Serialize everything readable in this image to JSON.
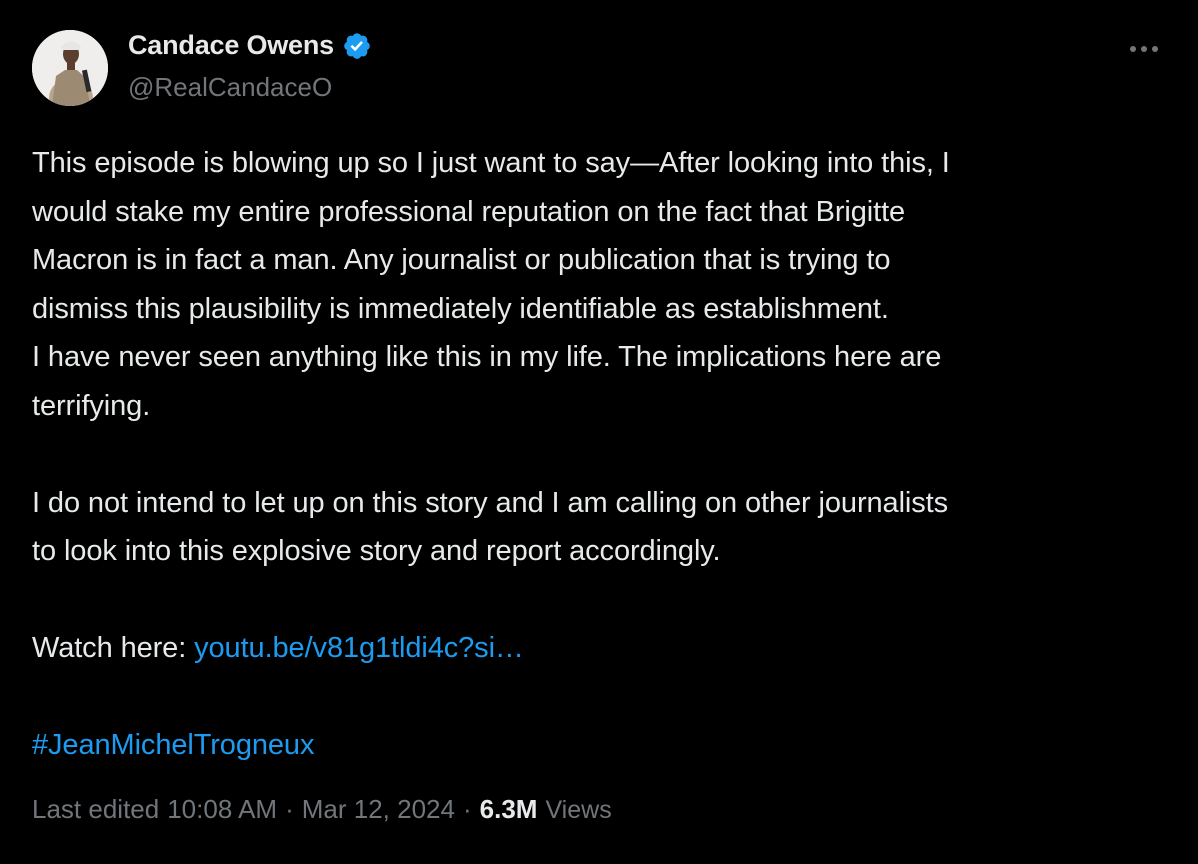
{
  "tweet": {
    "author": {
      "display_name": "Candace Owens",
      "handle": "@RealCandaceO",
      "verified_color": "#1d9bf0"
    },
    "body": {
      "paragraph1_lines": [
        "This episode is blowing up so I just want to say—After looking into this, I",
        "would stake my entire professional reputation on the fact that Brigitte",
        "Macron is in fact a man. Any journalist or publication that is trying to",
        "dismiss this plausibility is immediately identifiable as establishment.",
        "I have never seen anything like this in my life. The implications here are",
        "terrifying."
      ],
      "paragraph2_lines": [
        "I do not intend to let up on this story and I am calling on other journalists",
        "to look into this explosive story and report accordingly."
      ],
      "watch_prefix": "Watch here: ",
      "link_text": "youtu.be/v81g1tldi4c?si…",
      "hashtag": "#JeanMichelTrogneux"
    },
    "meta": {
      "edited_label": "Last edited",
      "time": "10:08 AM",
      "date": "Mar 12, 2024",
      "separator": "·",
      "views_count": "6.3M",
      "views_label": "Views"
    },
    "colors": {
      "background": "#000000",
      "text": "#e7e9ea",
      "muted": "#71767b",
      "link": "#1d9bf0"
    },
    "icons": {
      "more": "more-icon",
      "verified": "verified-badge-icon"
    }
  }
}
